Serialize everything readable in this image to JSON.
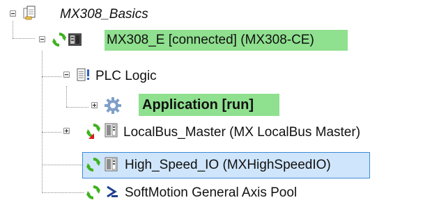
{
  "tree": {
    "project": {
      "label": "MX308_Basics",
      "icon": "project-document-icon",
      "expanded": true
    },
    "device": {
      "label": "MX308_E [connected] (MX308-CE)",
      "status": "connected",
      "icon": "plc-device-icon",
      "expanded": true
    },
    "plc_logic": {
      "label": "PLC Logic",
      "icon": "plc-logic-icon",
      "expanded": true
    },
    "application": {
      "label": "Application [run]",
      "status": "run",
      "icon": "application-gear-icon",
      "expanded": false
    },
    "localbus": {
      "label": "LocalBus_Master (MX LocalBus Master)",
      "icon": "io-module-icon",
      "expanded": false
    },
    "highspeed": {
      "label": "High_Speed_IO (MXHighSpeedIO)",
      "icon": "io-module-icon",
      "selected": true
    },
    "axis_pool": {
      "label": "SoftMotion General Axis Pool",
      "icon": "axis-pool-icon"
    }
  },
  "colors": {
    "connected_highlight": "#8fe08f",
    "selection_fill": "#cfe5fb",
    "selection_border": "#3c8ad8",
    "status_green": "#3fb21f",
    "error_red": "#d81b1b",
    "gear_blue": "#7f9fc9"
  }
}
